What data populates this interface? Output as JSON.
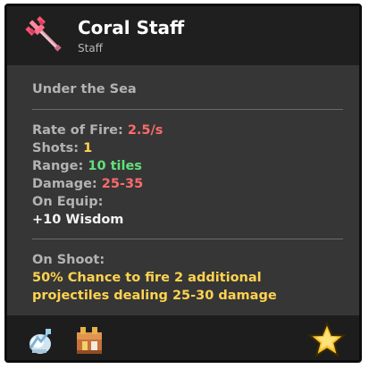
{
  "item": {
    "name": "Coral Staff",
    "type": "Staff",
    "description": "Under the Sea",
    "icon": "coral-staff-icon"
  },
  "stats": {
    "rate_of_fire_label": "Rate of Fire:",
    "rate_of_fire_value": "2.5/s",
    "shots_label": "Shots:",
    "shots_value": "1",
    "range_label": "Range:",
    "range_value": "10 tiles",
    "damage_label": "Damage:",
    "damage_value": "25-35",
    "on_equip_label": "On Equip:",
    "on_equip_value": "+10 Wisdom"
  },
  "on_shoot": {
    "label": "On Shoot:",
    "line1": "50% Chance to fire 2 additional",
    "line2": "projectiles dealing 25-30 damage"
  },
  "footer_icons": [
    "soulbound-icon",
    "backpack-icon",
    "favorite-star-icon"
  ],
  "colors": {
    "red_value": "#ff6b6b",
    "yellow_value": "#ffd34f",
    "green_value": "#63e07a",
    "card_bg": "#363636",
    "header_bg": "#1f1f1f"
  }
}
